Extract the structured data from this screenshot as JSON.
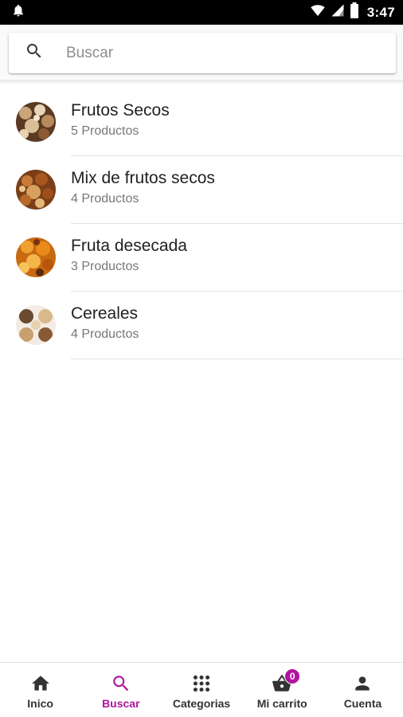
{
  "status_bar": {
    "time": "3:47",
    "icons": [
      "notification-bell-icon",
      "wifi-icon",
      "cell-signal-icon",
      "battery-icon"
    ]
  },
  "search": {
    "placeholder": "Buscar",
    "value": "",
    "icon": "search-icon"
  },
  "categories": [
    {
      "name": "Frutos Secos",
      "count": "5 Productos",
      "thumb": "nuts-thumbnail"
    },
    {
      "name": "Mix de frutos secos",
      "count": "4 Productos",
      "thumb": "mixed-nuts-thumbnail"
    },
    {
      "name": "Fruta desecada",
      "count": "3 Productos",
      "thumb": "dried-fruit-thumbnail"
    },
    {
      "name": "Cereales",
      "count": "4 Productos",
      "thumb": "cereals-thumbnail"
    }
  ],
  "bottom_nav": {
    "items": [
      {
        "label": "Inico",
        "icon": "home-icon"
      },
      {
        "label": "Buscar",
        "icon": "search-icon",
        "active": true
      },
      {
        "label": "Categorias",
        "icon": "grid-icon"
      },
      {
        "label": "Mi carrito",
        "icon": "shopping-basket-icon",
        "badge": "0"
      },
      {
        "label": "Cuenta",
        "icon": "person-icon"
      }
    ]
  },
  "colors": {
    "accent": "#b0149e",
    "status_bar": "#000000",
    "text_primary": "#212121",
    "text_secondary": "#777777"
  }
}
